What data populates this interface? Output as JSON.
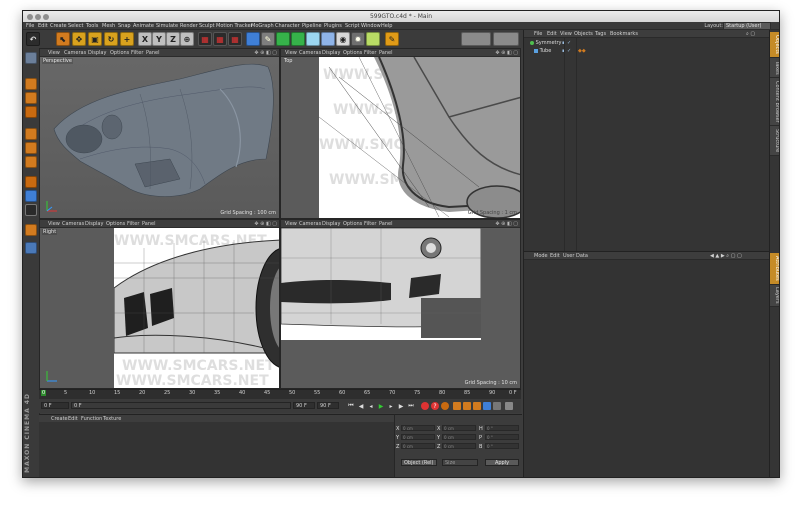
{
  "window": {
    "title": "599GTO.c4d * - Main"
  },
  "menu": [
    "File",
    "Edit",
    "Create",
    "Select",
    "Tools",
    "Mesh",
    "Snap",
    "Animate",
    "Simulate",
    "Render",
    "Sculpt",
    "Motion Tracker",
    "MoGraph",
    "Character",
    "Pipeline",
    "Plugins",
    "Script",
    "Window",
    "Help"
  ],
  "layout": {
    "label": "Layout:",
    "value": "Startup (User)"
  },
  "toolbar": {
    "axis_x": "X",
    "axis_y": "Y",
    "axis_z": "Z"
  },
  "viewport_menu": [
    "View",
    "Cameras",
    "Display",
    "Options",
    "Filter",
    "Panel"
  ],
  "viewports": {
    "perspective": {
      "name": "Perspective",
      "grid": "Grid Spacing : 100 cm"
    },
    "top": {
      "name": "Top",
      "grid": "Grid Spacing : 1 cm"
    },
    "right": {
      "name": "Right",
      "grid": ""
    },
    "front": {
      "name": "",
      "grid": "Grid Spacing : 10 cm"
    }
  },
  "watermark": "WWW.SMCARS.NET",
  "timeline": {
    "ticks": [
      "0",
      "5",
      "10",
      "15",
      "20",
      "25",
      "30",
      "35",
      "40",
      "45",
      "50",
      "55",
      "60",
      "65",
      "70",
      "75",
      "80",
      "85",
      "90"
    ],
    "end": "0 F"
  },
  "playback": {
    "start": "0 F",
    "current": "0 F",
    "max": "90 F",
    "end_field": "90 F"
  },
  "material": {
    "menu": [
      "Create",
      "Edit",
      "Function",
      "Texture"
    ]
  },
  "coords": {
    "rows": [
      {
        "a": "X",
        "v1": "0 cm",
        "b": "X",
        "v2": "0 cm",
        "c": "H",
        "v3": "0 °"
      },
      {
        "a": "Y",
        "v1": "0 cm",
        "b": "Y",
        "v2": "0 cm",
        "c": "P",
        "v3": "0 °"
      },
      {
        "a": "Z",
        "v1": "0 cm",
        "b": "Z",
        "v2": "0 cm",
        "c": "B",
        "v3": "0 °"
      }
    ],
    "mode": "Object (Rel)",
    "size": "Size",
    "apply": "Apply"
  },
  "object_manager": {
    "menu": [
      "File",
      "Edit",
      "View",
      "Objects",
      "Tags",
      "Bookmarks"
    ],
    "objects": [
      {
        "name": "Symmetry",
        "color": "#4fbf4f"
      },
      {
        "name": "Tube",
        "color": "#5aa0e0"
      }
    ]
  },
  "attribute_manager": {
    "menu": [
      "Mode",
      "Edit",
      "User Data"
    ]
  },
  "right_tabs": [
    "Objects",
    "Takes",
    "Content Browser",
    "Structure",
    "Attributes",
    "Layers"
  ],
  "brand": "MAXON CINEMA 4D"
}
